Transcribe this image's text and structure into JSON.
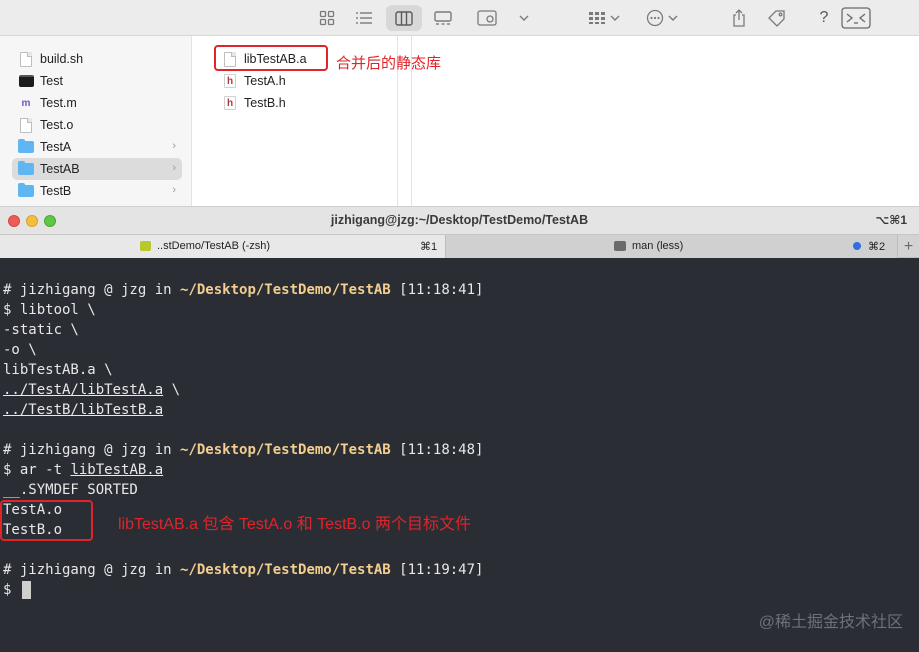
{
  "finder": {
    "sidebar_items": [
      {
        "name": "build.sh",
        "icon": "document-icon"
      },
      {
        "name": "Test",
        "icon": "terminal-executable-icon"
      },
      {
        "name": "Test.m",
        "icon": "objc-source-icon",
        "badge": "m"
      },
      {
        "name": "Test.o",
        "icon": "document-icon"
      },
      {
        "name": "TestA",
        "icon": "folder-icon"
      },
      {
        "name": "TestAB",
        "icon": "folder-icon",
        "selected": true
      },
      {
        "name": "TestB",
        "icon": "folder-icon"
      }
    ],
    "files": [
      {
        "name": "libTestAB.a",
        "icon": "document-icon"
      },
      {
        "name": "TestA.h",
        "icon": "header-file-icon",
        "badge": "h"
      },
      {
        "name": "TestB.h",
        "icon": "header-file-icon",
        "badge": "h"
      }
    ],
    "annotation": "合并后的静态库",
    "help_label": "?"
  },
  "terminal": {
    "title": "jizhigang@jzg:~/Desktop/TestDemo/TestAB",
    "window_shortcut": "⌥⌘1",
    "tabs": [
      {
        "label": "..stDemo/TestAB (-zsh)",
        "shortcut": "⌘1",
        "active": true
      },
      {
        "label": "man (less)",
        "shortcut": "⌘2",
        "active": false
      }
    ],
    "add_tab_label": "+",
    "prompt_user": "# jizhigang @ jzg in",
    "path": "~/Desktop/TestDemo/TestAB",
    "block1": {
      "time": "[11:18:41]",
      "cmd": "$ libtool \\",
      "l2": "-static \\",
      "l3": "-o \\",
      "l4": "libTestAB.a \\",
      "l5_file": "../TestA/libTestA.a",
      "l5_tail": " \\",
      "l6_file": "../TestB/libTestB.a"
    },
    "block2": {
      "time": "[11:18:48]",
      "cmd_prefix": "$ ar -t ",
      "cmd_file": "libTestAB.a",
      "out1": "__.SYMDEF SORTED",
      "out2": "TestA.o",
      "out3": "TestB.o"
    },
    "block3": {
      "time": "[11:19:47]",
      "prompt": "$"
    },
    "annotation": "libTestAB.a 包含 TestA.o 和 TestB.o 两个目标文件",
    "watermark": "@稀土掘金技术社区"
  },
  "colors": {
    "annotation_red": "#e0242a",
    "terminal_bg": "#2b2d35",
    "path_yellow": "#f2ce8f",
    "folder_blue": "#5fb6f2",
    "tab_badge_blue": "#2f6fe0"
  }
}
